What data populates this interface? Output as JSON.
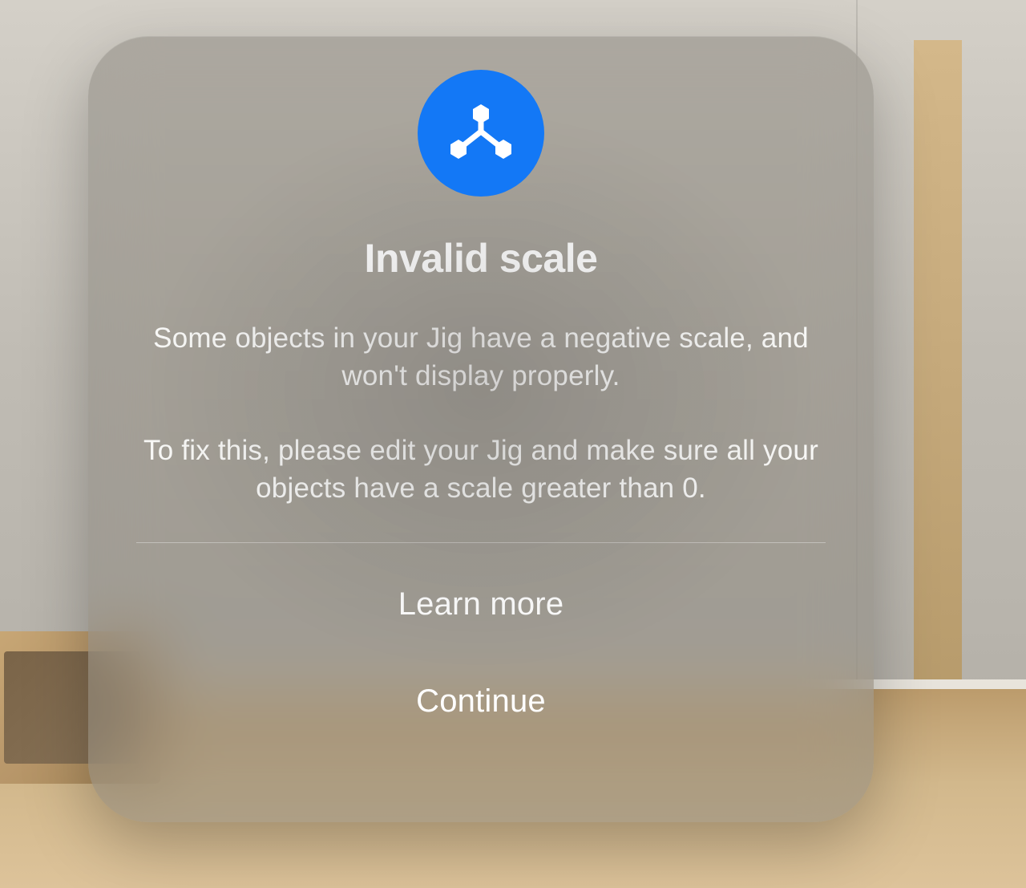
{
  "dialog": {
    "icon_name": "jig-logo-icon",
    "icon_bg_color": "#1378f6",
    "title": "Invalid scale",
    "body_line1": "Some objects in your Jig have a negative scale, and won't display properly.",
    "body_line2": "To fix this, please edit your Jig and make sure all your objects have a scale greater than 0.",
    "learn_more_label": "Learn more",
    "continue_label": "Continue"
  }
}
